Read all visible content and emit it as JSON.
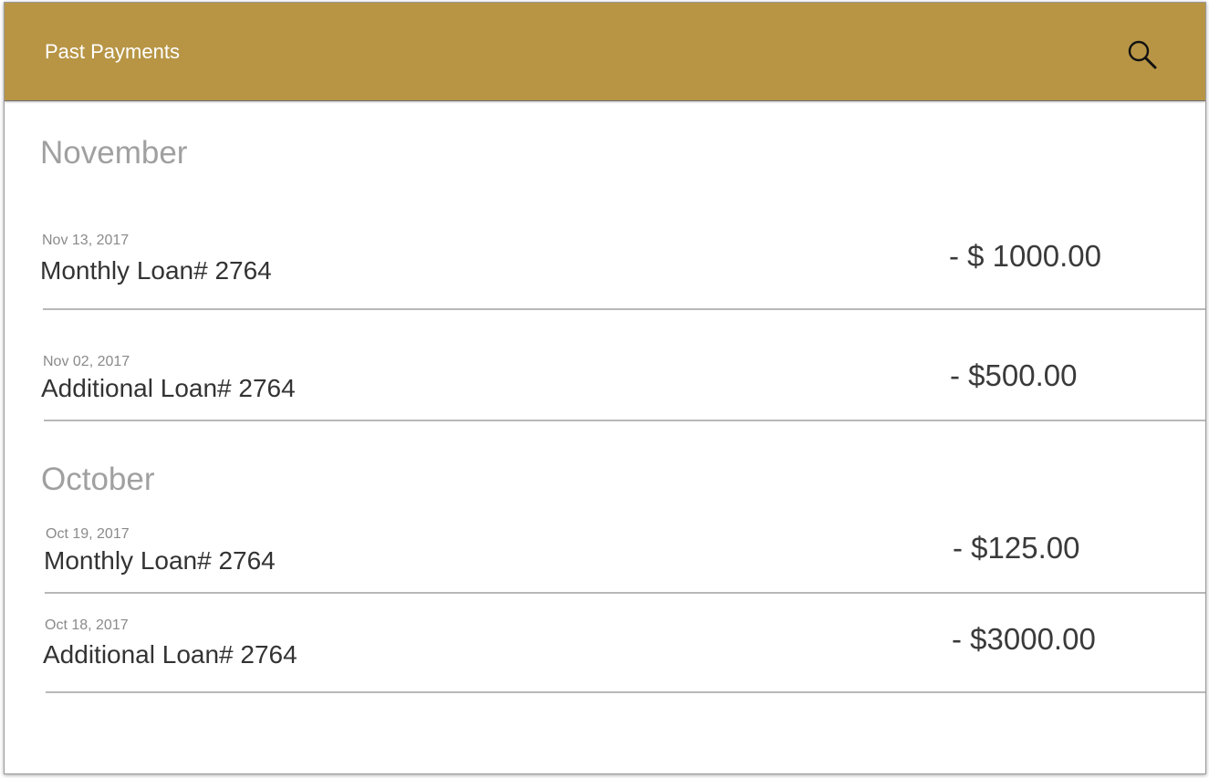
{
  "header": {
    "title": "Past Payments",
    "search_icon": "search-icon",
    "background_color": "#b79545"
  },
  "groups": [
    {
      "month": "November",
      "payments": [
        {
          "date": "Nov 13, 2017",
          "description": "Monthly Loan# 2764",
          "amount": "- $ 1000.00"
        },
        {
          "date": "Nov 02, 2017",
          "description": "Additional Loan# 2764",
          "amount": "- $500.00"
        }
      ]
    },
    {
      "month": "October",
      "payments": [
        {
          "date": "Oct 19, 2017",
          "description": "Monthly Loan# 2764",
          "amount": "- $125.00"
        },
        {
          "date": "Oct 18, 2017",
          "description": "Additional Loan# 2764",
          "amount": "- $3000.00"
        }
      ]
    }
  ]
}
